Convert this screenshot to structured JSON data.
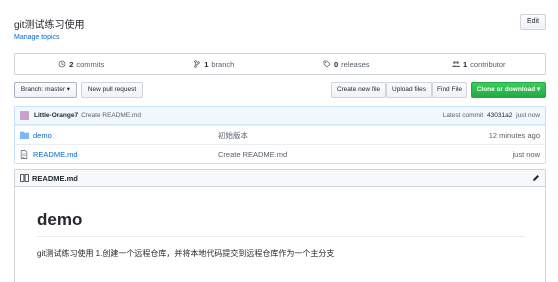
{
  "repo": {
    "description": "git测试练习使用",
    "manage_topics": "Manage topics",
    "edit_label": "Edit"
  },
  "numbers": {
    "commits_count": "2",
    "commits_label": "commits",
    "branch_count": "1",
    "branch_label": "branch",
    "releases_count": "0",
    "releases_label": "releases",
    "contributor_count": "1",
    "contributor_label": "contributor"
  },
  "toolbar": {
    "branch_label": "Branch: master ▾",
    "pull_request_label": "New pull request",
    "create_file_label": "Create new file",
    "upload_files_label": "Upload files",
    "find_file_label": "Find File",
    "clone_label": "Clone or download ▾"
  },
  "commit": {
    "author": "Little-Orange7",
    "message": "Create README.md",
    "latest_prefix": "Latest commit",
    "sha": "43031a2",
    "age": "just now"
  },
  "files": [
    {
      "name": "demo",
      "message": "初始版本",
      "age": "12 minutes ago",
      "icon": "folder-icon"
    },
    {
      "name": "README.md",
      "message": "Create README.md",
      "age": "just now",
      "icon": "file-icon"
    }
  ],
  "readme": {
    "title": "README.md",
    "heading": "demo",
    "body": "git测试练习使用 1.创建一个远程仓库，并将本地代码提交到远程仓库作为一个主分支"
  },
  "colors": {
    "link": "#0366d6",
    "clone_button": "#28a745",
    "commit_bar": "#f1f8ff"
  }
}
